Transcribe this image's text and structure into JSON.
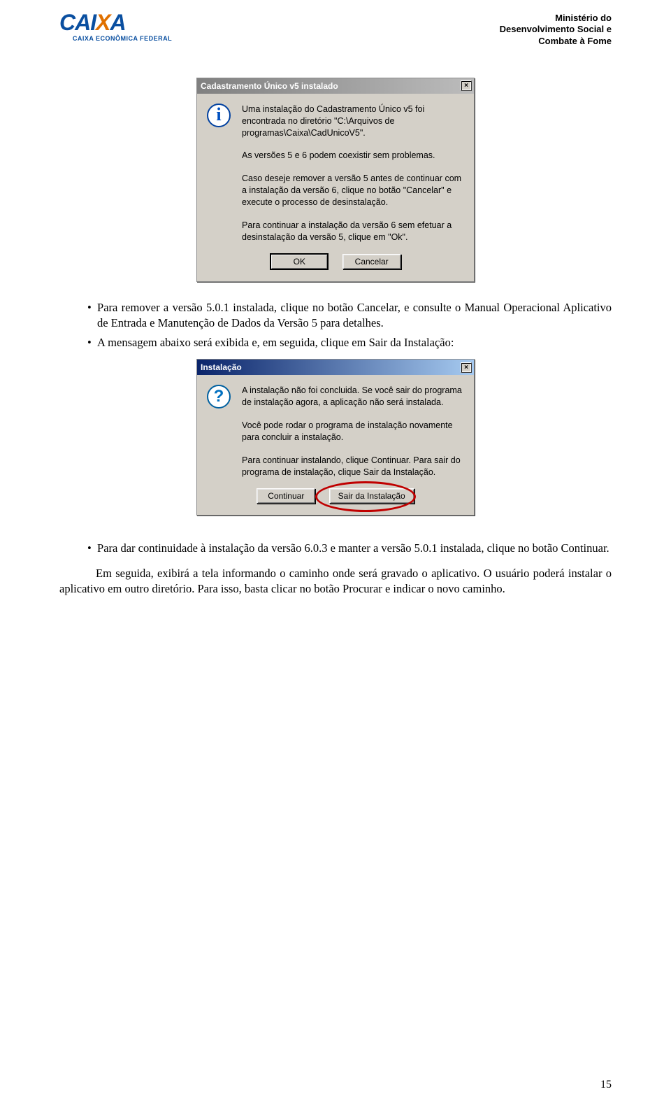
{
  "header": {
    "logo_main": "CAIXA",
    "logo_sub": "CAIXA ECONÔMICA FEDERAL",
    "ministry_l1": "Ministério do",
    "ministry_l2": "Desenvolvimento Social e",
    "ministry_l3": "Combate à Fome"
  },
  "dialog1": {
    "title": "Cadastramento Único v5 instalado",
    "p1": "Uma instalação do Cadastramento Único v5 foi encontrada no diretório \"C:\\Arquivos de programas\\Caixa\\CadUnicoV5\".",
    "p2": "As versões 5 e 6 podem coexistir sem problemas.",
    "p3": "Caso deseje remover a versão 5 antes de continuar com a instalação da versão 6, clique no botão \"Cancelar\" e execute o processo de desinstalação.",
    "p4": "Para continuar a instalação da versão 6 sem efetuar a desinstalação da versão 5, clique em \"Ok\".",
    "btn_ok": "OK",
    "btn_cancel": "Cancelar",
    "close": "×"
  },
  "text_block1_bullet1": "Para remover a versão 5.0.1 instalada, clique no botão Cancelar, e consulte o Manual Operacional Aplicativo de Entrada e Manutenção de Dados da Versão 5 para detalhes.",
  "text_block1_bullet2": "A mensagem abaixo será exibida e, em seguida, clique em Sair da Instalação:",
  "dialog2": {
    "title": "Instalação",
    "p1": "A instalação não foi concluida.  Se você sair do programa de instalação agora, a aplicação não será instalada.",
    "p2": "Você pode rodar o programa de instalação novamente para concluir a instalação.",
    "p3": "Para continuar instalando, clique Continuar. Para sair do programa de instalação, clique Sair da Instalação.",
    "btn_continue": "Continuar",
    "btn_exit": "Sair da Instalação",
    "close": "×"
  },
  "text_block2_bullet": "Para dar continuidade à instalação da versão 6.0.3 e manter a versão 5.0.1 instalada, clique no botão Continuar.",
  "text_block2_para": "Em seguida, exibirá a tela informando o caminho onde será gravado o aplicativo. O usuário poderá instalar o aplicativo em outro diretório. Para isso, basta clicar no botão Procurar e indicar o novo caminho.",
  "page_number": "15"
}
